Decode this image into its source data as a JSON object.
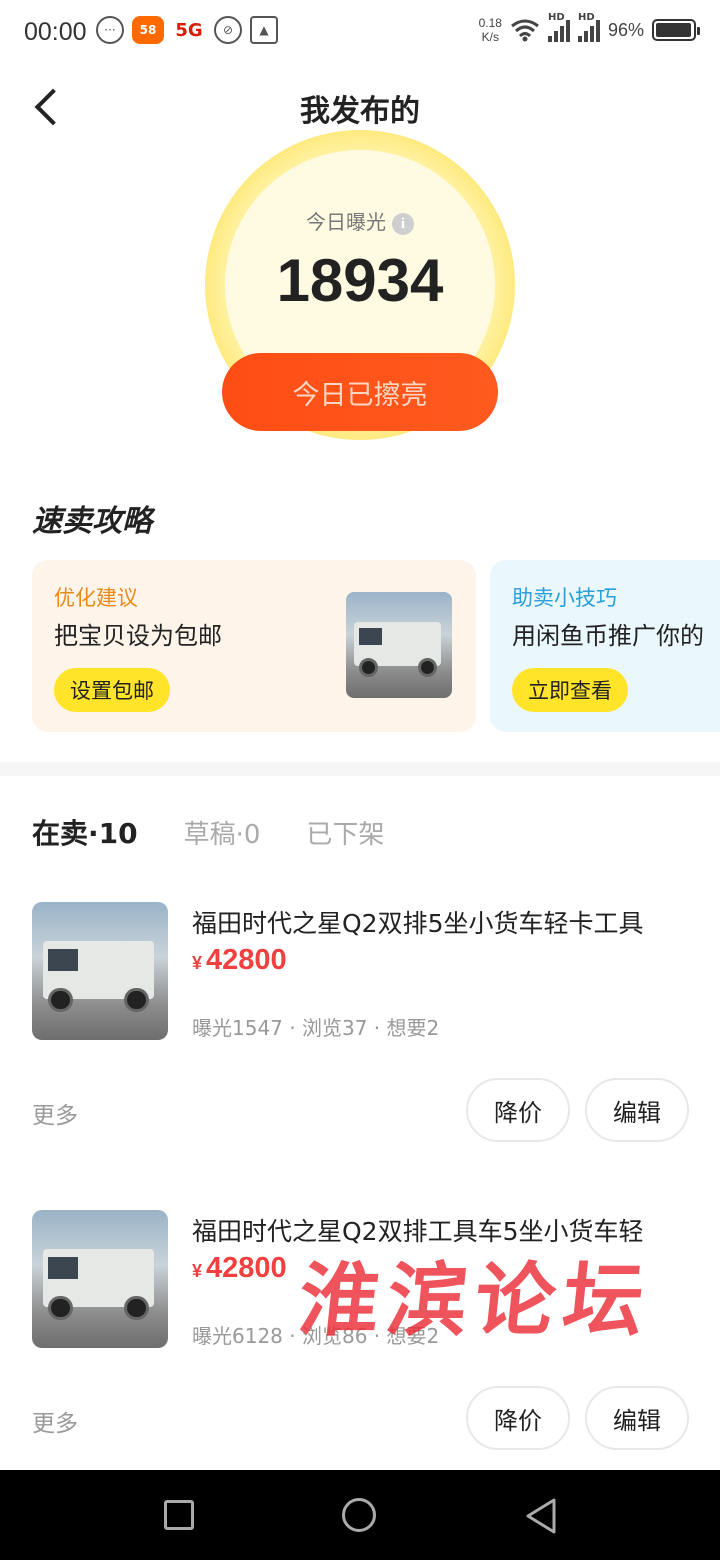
{
  "status_bar": {
    "time": "00:00",
    "speed_value": "0.18",
    "speed_unit": "K/s",
    "hd1": "HD",
    "hd2": "HD",
    "battery": "96%",
    "badge_58": "58",
    "badge_5g": "5G",
    "icons": [
      "chat-bubble-icon",
      "app-58-icon",
      "5g-icon",
      "pin-icon",
      "image-icon",
      "wifi-icon",
      "signal-icon",
      "battery-icon"
    ]
  },
  "header": {
    "title": "我发布的"
  },
  "exposure": {
    "label": "今日曝光",
    "value": "18934",
    "button": "今日已擦亮"
  },
  "tips": {
    "title": "速卖攻略",
    "cards": [
      {
        "tag": "优化建议",
        "text": "把宝贝设为包邮",
        "button": "设置包邮"
      },
      {
        "tag": "助卖小技巧",
        "text": "用闲鱼币推广你的",
        "button": "立即查看"
      }
    ]
  },
  "tabs": [
    {
      "label": "在卖·10",
      "active": true
    },
    {
      "label": "草稿·0",
      "active": false
    },
    {
      "label": "已下架",
      "active": false
    }
  ],
  "listings": [
    {
      "title": "福田时代之星Q2双排5坐小货车轻卡工具",
      "currency": "¥",
      "price": "42800",
      "stats": "曝光1547 · 浏览37 · 想要2",
      "more": "更多",
      "reduce_price": "降价",
      "edit": "编辑"
    },
    {
      "title": "福田时代之星Q2双排工具车5坐小货车轻",
      "currency": "¥",
      "price": "42800",
      "stats": "曝光6128 · 浏览86 · 想要2",
      "more": "更多",
      "reduce_price": "降价",
      "edit": "编辑"
    }
  ],
  "watermark": "淮滨论坛",
  "colors": {
    "accent_orange": "#ff4d14",
    "price_red": "#f04040",
    "tip_yellow": "#ffe42a"
  }
}
